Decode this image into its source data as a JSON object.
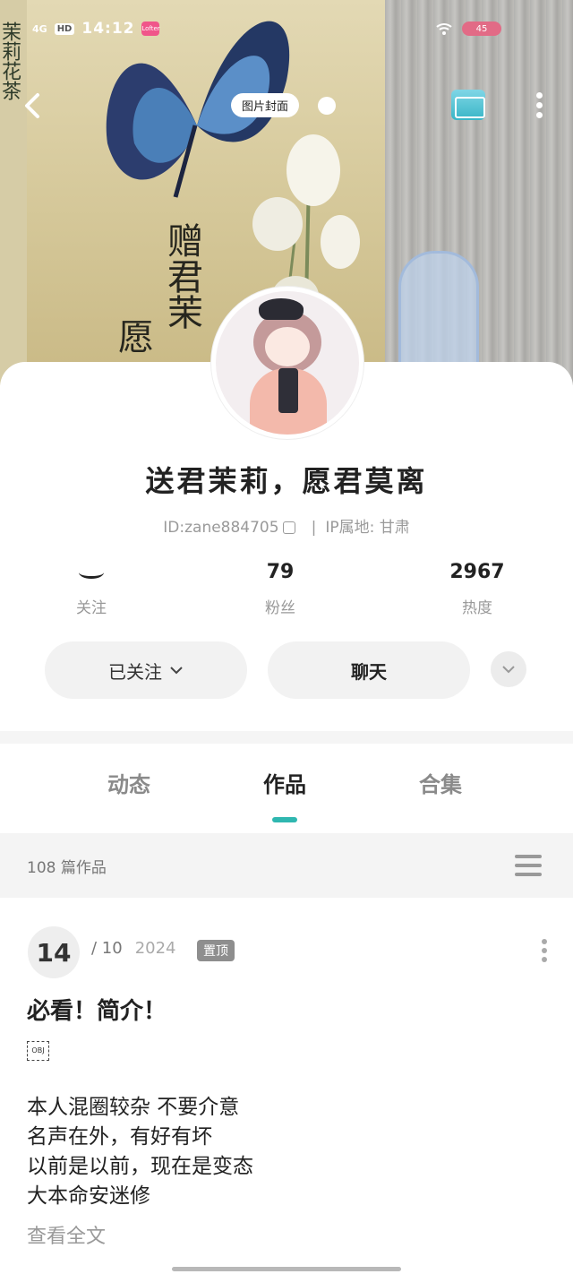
{
  "status_bar": {
    "network": "4G",
    "hd": "HD",
    "time": "14:12",
    "app_badge": "Lofter",
    "battery": "45"
  },
  "cover": {
    "tag": "图片封面",
    "side_text": "茉莉花茶",
    "poem_line1": "赠君茉",
    "poem_line2": "愿"
  },
  "profile": {
    "name": "送君茉莉，愿君莫离",
    "id": "ID:zane884705",
    "ip": "IP属地: 甘肃",
    "stats": [
      {
        "value": "",
        "label": "关注"
      },
      {
        "value": "79",
        "label": "粉丝"
      },
      {
        "value": "2967",
        "label": "热度"
      }
    ],
    "follow_label": "已关注",
    "chat_label": "聊天"
  },
  "tabs": [
    "动态",
    "作品",
    "合集"
  ],
  "active_tab": "作品",
  "works_count": "108 篇作品",
  "post": {
    "day": "14",
    "month": "/ 10",
    "year": "2024",
    "pin": "置顶",
    "title": "必看！简介！",
    "obj": "OBJ",
    "lines": [
      "本人混圈较杂 不要介意",
      "名声在外，有好有坏",
      "以前是以前，现在是变态",
      "大本命安迷修"
    ],
    "read_more": "查看全文"
  },
  "colors": {
    "accent": "#2fb7b0",
    "badge": "#8e8e8e",
    "button_bg": "#f2f2f2"
  },
  "icons": [
    "back-arrow-icon",
    "mail-icon",
    "more-vertical-icon",
    "copy-icon",
    "eye-closed-icon",
    "chevron-down-icon",
    "menu-icon"
  ]
}
